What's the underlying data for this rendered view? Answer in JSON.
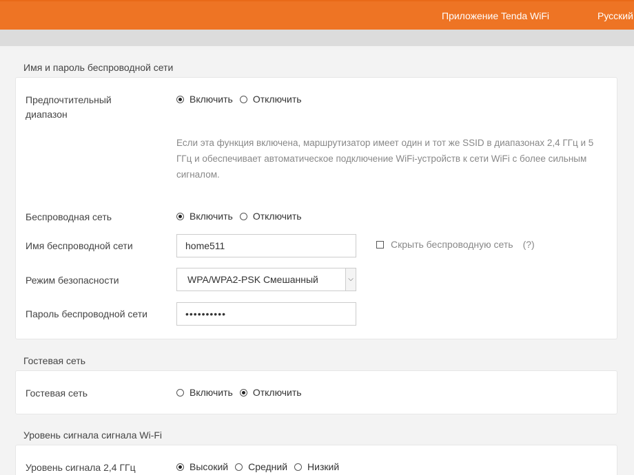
{
  "topbar": {
    "app_link": "Приложение Tenda WiFi",
    "language": "Русский"
  },
  "wireless": {
    "section_title": "Имя и пароль беспроводной сети",
    "preferred_band": {
      "label": "Предпочтительный диапазон",
      "options": [
        "Включить",
        "Отключить"
      ],
      "selected": "Включить",
      "help": "Если эта функция включена, маршрутизатор имеет один и тот же SSID в диапазонах 2,4 ГГц и 5 ГГц и обеспечивает автоматическое подключение WiFi-устройств к сети WiFi с более сильным сигналом."
    },
    "wireless_network": {
      "label": "Беспроводная сеть",
      "options": [
        "Включить",
        "Отключить"
      ],
      "selected": "Включить"
    },
    "ssid": {
      "label": "Имя беспроводной сети",
      "value": "home511",
      "hide_label": "Скрыть беспроводную сеть",
      "hide_checked": false,
      "help_mark": "(?)"
    },
    "security": {
      "label": "Режим безопасности",
      "value": "WPA/WPA2-PSK Смешанный"
    },
    "password": {
      "label": "Пароль беспроводной сети",
      "value": "••••••••••"
    }
  },
  "guest": {
    "section_title": "Гостевая сеть",
    "label": "Гостевая сеть",
    "options": [
      "Включить",
      "Отключить"
    ],
    "selected": "Отключить"
  },
  "signal": {
    "section_title": "Уровень сигнала сигнала Wi-Fi",
    "label": "Уровень сигнала 2,4 ГГц",
    "options": [
      "Высокий",
      "Средний",
      "Низкий"
    ],
    "selected": "Высокий"
  },
  "icons": {
    "select_arrow": "chevron-down-icon"
  }
}
